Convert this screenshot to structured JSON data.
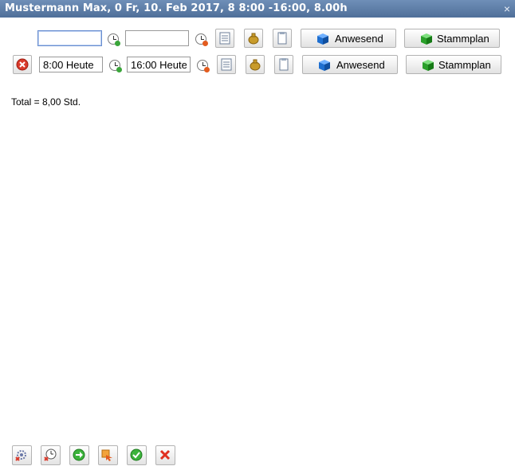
{
  "window": {
    "title": "Mustermann Max, 0 Fr, 10. Feb 2017, 8 8:00 -16:00, 8.00h",
    "close_glyph": "×"
  },
  "rows": [
    {
      "from_value": "",
      "to_value": "",
      "present_label": "Anwesend",
      "plan_label": "Stammplan"
    },
    {
      "from_value": "8:00 Heute",
      "to_value": "16:00 Heute",
      "present_label": "Anwesend",
      "plan_label": "Stammplan"
    }
  ],
  "total_text": "Total = 8,00 Std.",
  "icons": {
    "delete": "delete-row-icon",
    "start_clock": "clock-start-icon",
    "end_clock": "clock-end-icon",
    "list": "list-icon",
    "money": "money-bag-icon",
    "note": "note-icon",
    "present": "blue-cube-icon",
    "plan": "green-cube-icon"
  },
  "footer_buttons": [
    {
      "name": "settings-button",
      "icon": "gear-x-icon"
    },
    {
      "name": "reset-button",
      "icon": "clock-x-icon"
    },
    {
      "name": "next-button",
      "icon": "green-arrow-icon"
    },
    {
      "name": "export-button",
      "icon": "orange-arrow-icon"
    },
    {
      "name": "confirm-button",
      "icon": "green-check-icon"
    },
    {
      "name": "cancel-button",
      "icon": "red-x-icon"
    }
  ],
  "colors": {
    "titlebar": "#5a7aa5",
    "present_cube": "#1e6fd0",
    "plan_cube": "#2aa02a",
    "delete_red": "#d93a2b"
  }
}
